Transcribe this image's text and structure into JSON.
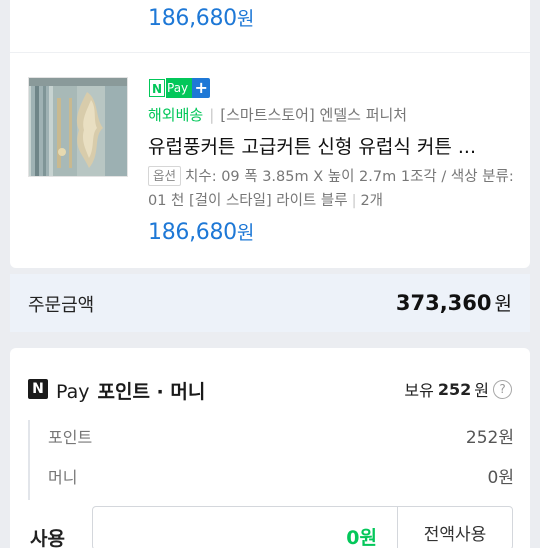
{
  "items": [
    {
      "price": "186,680",
      "currency": "원"
    },
    {
      "npay_badge": {
        "n": "N",
        "pay": "Pay",
        "plus": "+"
      },
      "shipping": "해외배송",
      "store": "[스마트스토어] 엔델스 퍼니처",
      "title": "유럽풍커튼 고급커튼 신형 유럽식 커튼 ...",
      "option_tag": "옵션",
      "option_text": "치수: 09 폭 3.85m X 높이 2.7m 1조각 / 색상 분류: 01 천 [걸이 스타일] 라이트 블루",
      "quantity": "2개",
      "price": "186,680",
      "currency": "원"
    }
  ],
  "order_total": {
    "label": "주문금액",
    "value": "373,360",
    "currency": "원"
  },
  "npay_points": {
    "logo": "N",
    "pay_word": "Pay",
    "title": "포인트 · 머니",
    "owned_label": "보유",
    "owned_value": "252",
    "owned_currency": "원",
    "help": "?",
    "rows": [
      {
        "label": "포인트",
        "value": "252원"
      },
      {
        "label": "머니",
        "value": "0원"
      }
    ],
    "use_label": "사용",
    "use_value": "0원",
    "use_all_button": "전액사용"
  },
  "colors": {
    "price_blue": "#1e78d6",
    "npay_green": "#03c75a",
    "background": "#ebedf1",
    "total_bar": "#edf2f9"
  },
  "icons": [
    "npay-logo-icon",
    "help-icon"
  ]
}
